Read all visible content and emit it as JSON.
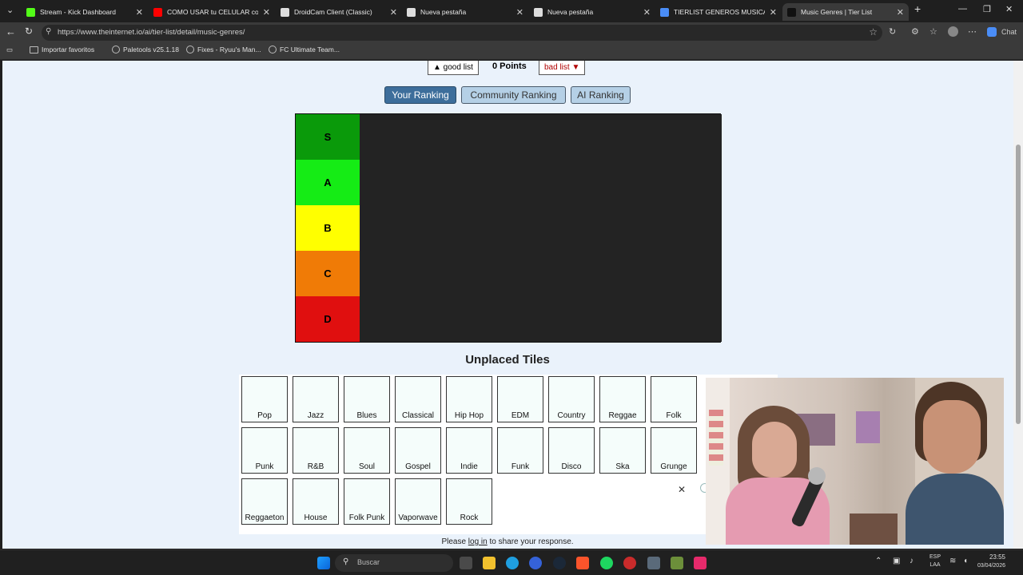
{
  "browser": {
    "tabs": [
      {
        "title": "Stream - Kick Dashboard",
        "color": "#53fc18"
      },
      {
        "title": "COMO USAR tu CELULAR como M",
        "color": "#ff0000"
      },
      {
        "title": "DroidCam Client (Classic)",
        "color": "#dddddd"
      },
      {
        "title": "Nueva pestaña",
        "color": "#dddddd"
      },
      {
        "title": "Nueva pestaña",
        "color": "#dddddd"
      },
      {
        "title": "TIERLIST GENEROS MUSICALES - L",
        "color": "#4a8df7"
      },
      {
        "title": "Music Genres | Tier List",
        "color": "#111111"
      }
    ],
    "url": "https://www.theinternet.io/ai/tier-list/detail/music-genres/",
    "right_label": "Chat",
    "bookmarks": [
      "Importar favoritos",
      "Paletools v25.1.18",
      "Fixes - Ryuu's Man...",
      "FC Ultimate Team..."
    ]
  },
  "page": {
    "vote_good": "▲ good list",
    "points": "0 Points",
    "vote_bad": "bad list ▼",
    "ranking_buttons": [
      "Your Ranking",
      "Community Ranking",
      "AI Ranking"
    ],
    "tiers": [
      {
        "label": "S",
        "color": "#0a9a0a"
      },
      {
        "label": "A",
        "color": "#15ec15"
      },
      {
        "label": "B",
        "color": "#ffff00"
      },
      {
        "label": "C",
        "color": "#f07b06"
      },
      {
        "label": "D",
        "color": "#e00f0f"
      }
    ],
    "unplaced_title": "Unplaced Tiles",
    "tiles": [
      "Pop",
      "Jazz",
      "Blues",
      "Classical",
      "Hip Hop",
      "EDM",
      "Country",
      "Reggae",
      "Folk",
      "Punk",
      "R&B",
      "Soul",
      "Gospel",
      "Indie",
      "Funk",
      "Disco",
      "Ska",
      "Grunge",
      "Reggaeton",
      "House",
      "Folk Punk",
      "Vaporwave",
      "Rock"
    ],
    "login_pre": "Please ",
    "login_link": "log in",
    "login_post": " to share your response."
  },
  "taskbar": {
    "search_placeholder": "Buscar",
    "lang": "ESP\nLAA",
    "time": "23:55",
    "date": "03/04/2026"
  }
}
